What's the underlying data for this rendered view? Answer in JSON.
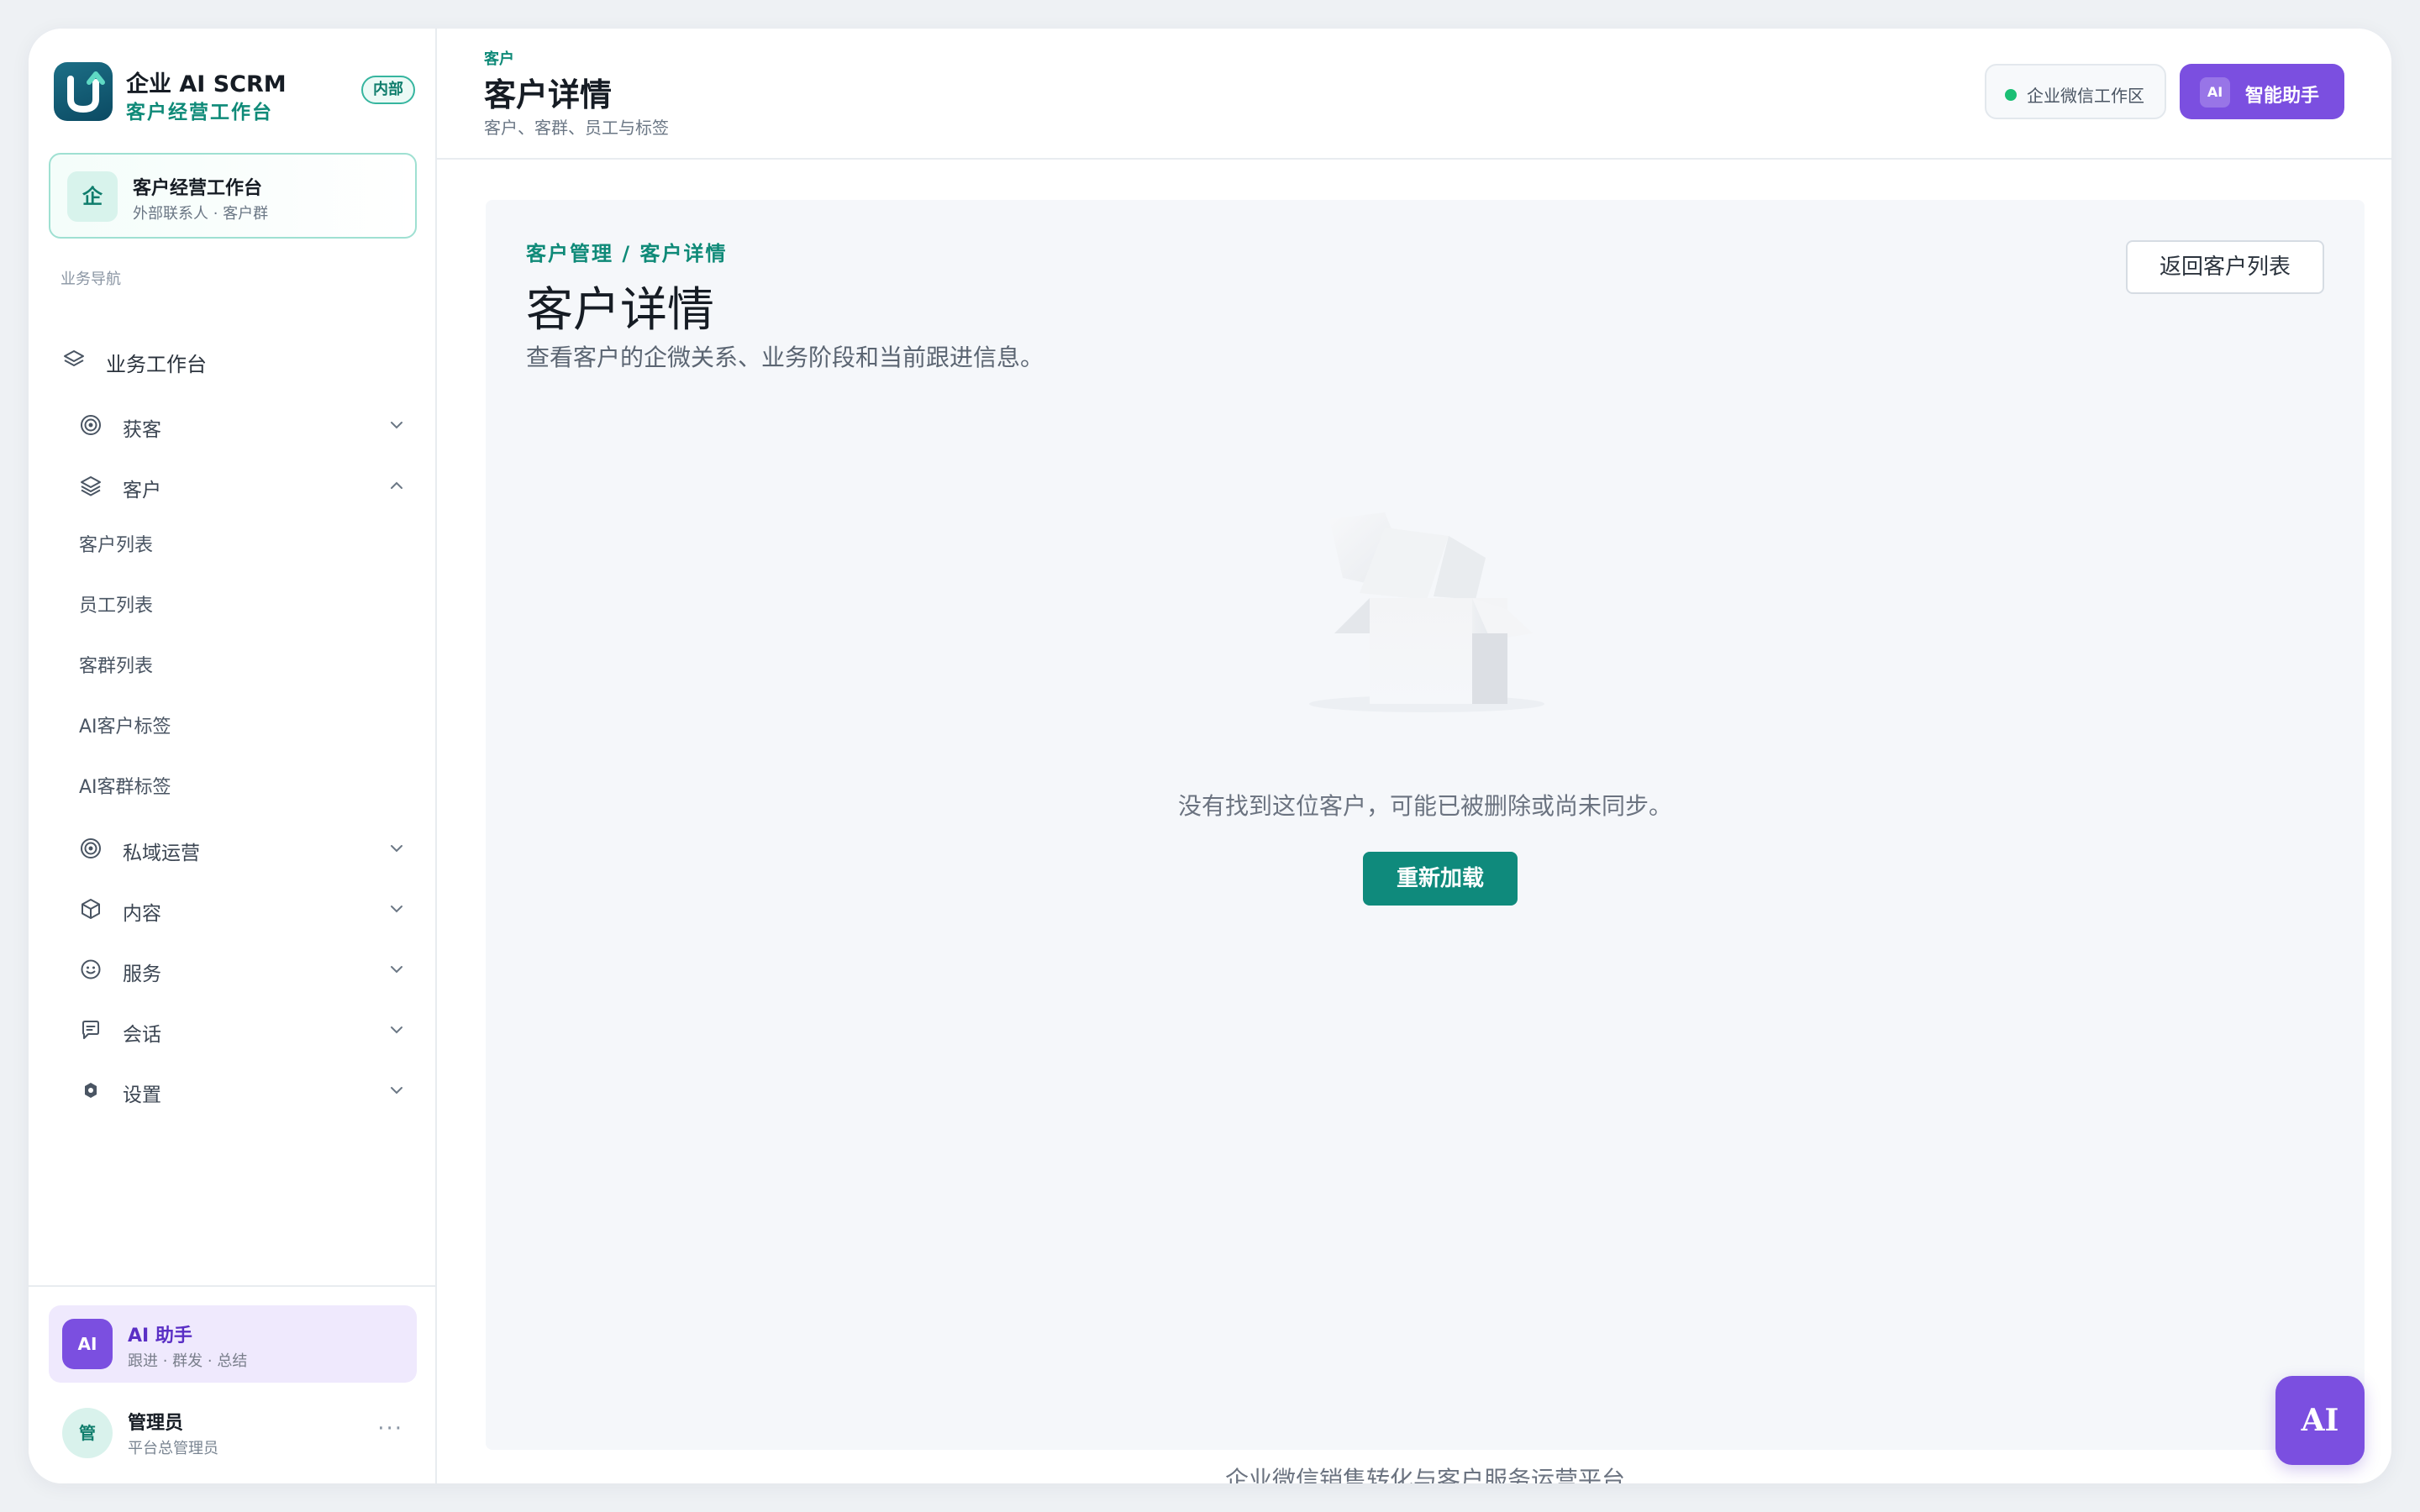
{
  "brand": {
    "title": "企业 AI SCRM",
    "subtitle": "客户经营工作台",
    "badge": "内部"
  },
  "workspace": {
    "icon_text": "企",
    "title": "客户经营工作台",
    "subtitle": "外部联系人 · 客户群"
  },
  "nav": {
    "section_label": "业务导航",
    "top_item": {
      "label": "业务工作台",
      "icon": "layers-icon"
    },
    "groups": [
      {
        "label": "获客",
        "icon": "target-icon",
        "expanded": false
      },
      {
        "label": "客户",
        "icon": "layers-icon",
        "expanded": true
      },
      {
        "label": "私域运营",
        "icon": "target-icon",
        "expanded": false
      },
      {
        "label": "内容",
        "icon": "cube-icon",
        "expanded": false
      },
      {
        "label": "服务",
        "icon": "smile-icon",
        "expanded": false
      },
      {
        "label": "会话",
        "icon": "chat-icon",
        "expanded": false
      },
      {
        "label": "设置",
        "icon": "settings-icon",
        "expanded": false
      }
    ],
    "customer_subitems": [
      "客户列表",
      "员工列表",
      "客群列表",
      "AI客户标签",
      "AI客群标签"
    ]
  },
  "ai_card": {
    "avatar": "AI",
    "title": "AI 助手",
    "subtitle": "跟进 · 群发 · 总结"
  },
  "user": {
    "avatar": "管",
    "name": "管理员",
    "role": "平台总管理员",
    "more": "···"
  },
  "header": {
    "breadcrumb": "客户",
    "title": "客户详情",
    "subtitle": "客户、客群、员工与标签",
    "env_label": "企业微信工作区",
    "assistant_icon": "AI",
    "assistant_label": "智能助手"
  },
  "main": {
    "breadcrumb": "客户管理 / 客户详情",
    "title": "客户详情",
    "description": "查看客户的企微关系、业务阶段和当前跟进信息。",
    "back_button": "返回客户列表",
    "empty_message": "没有找到这位客户，可能已被删除或尚未同步。",
    "reload_button": "重新加载"
  },
  "footer": {
    "text": "企业微信销售转化与客户服务运营平台"
  },
  "fab": {
    "label": "AI"
  },
  "colors": {
    "brand_teal": "#0f8a78",
    "accent_purple": "#7b4fe0",
    "status_green": "#1bbf74",
    "page_bg": "#eef1f4"
  }
}
